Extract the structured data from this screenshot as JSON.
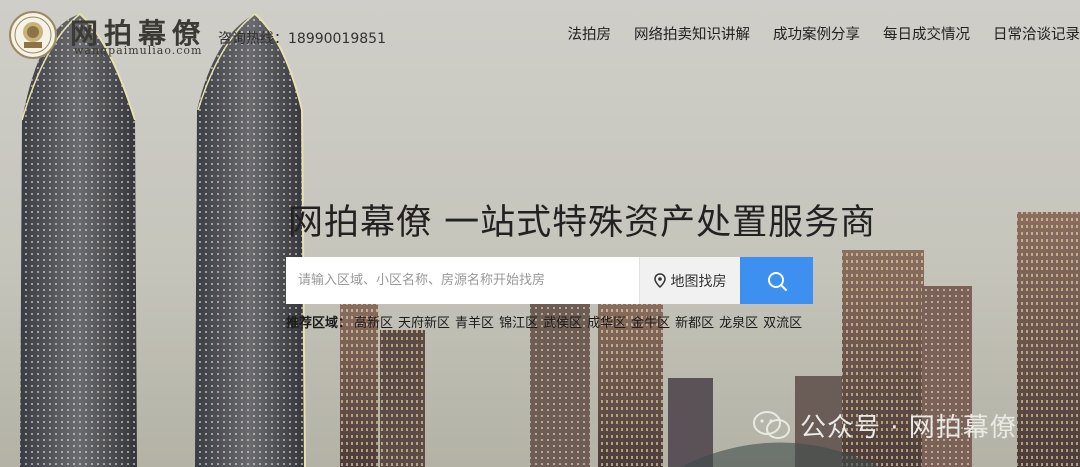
{
  "brand": {
    "name": "网拍幕僚",
    "domain": "wangpaimuliao.com"
  },
  "header": {
    "hotline_label": "咨询热线：",
    "hotline_number": "18990019851",
    "nav": [
      {
        "label": "法拍房"
      },
      {
        "label": "网络拍卖知识讲解"
      },
      {
        "label": "成功案例分享"
      },
      {
        "label": "每日成交情况"
      },
      {
        "label": "日常洽谈记录"
      }
    ]
  },
  "hero": {
    "headline": "网拍幕僚 一站式特殊资产处置服务商"
  },
  "search": {
    "placeholder": "请输入区域、小区名称、房源名称开始找房",
    "map_button_label": "地图找房",
    "search_icon": "search-icon",
    "location_icon": "location-pin-icon",
    "accent_color": "#3d8ff0"
  },
  "regions": {
    "label": "推荐区域：",
    "items": [
      "高新区",
      "天府新区",
      "青羊区",
      "锦江区",
      "武侯区",
      "成华区",
      "金牛区",
      "新都区",
      "龙泉区",
      "双流区"
    ]
  },
  "watermark": {
    "text": "公众号 · 网拍幕僚",
    "icon": "wechat-icon"
  }
}
